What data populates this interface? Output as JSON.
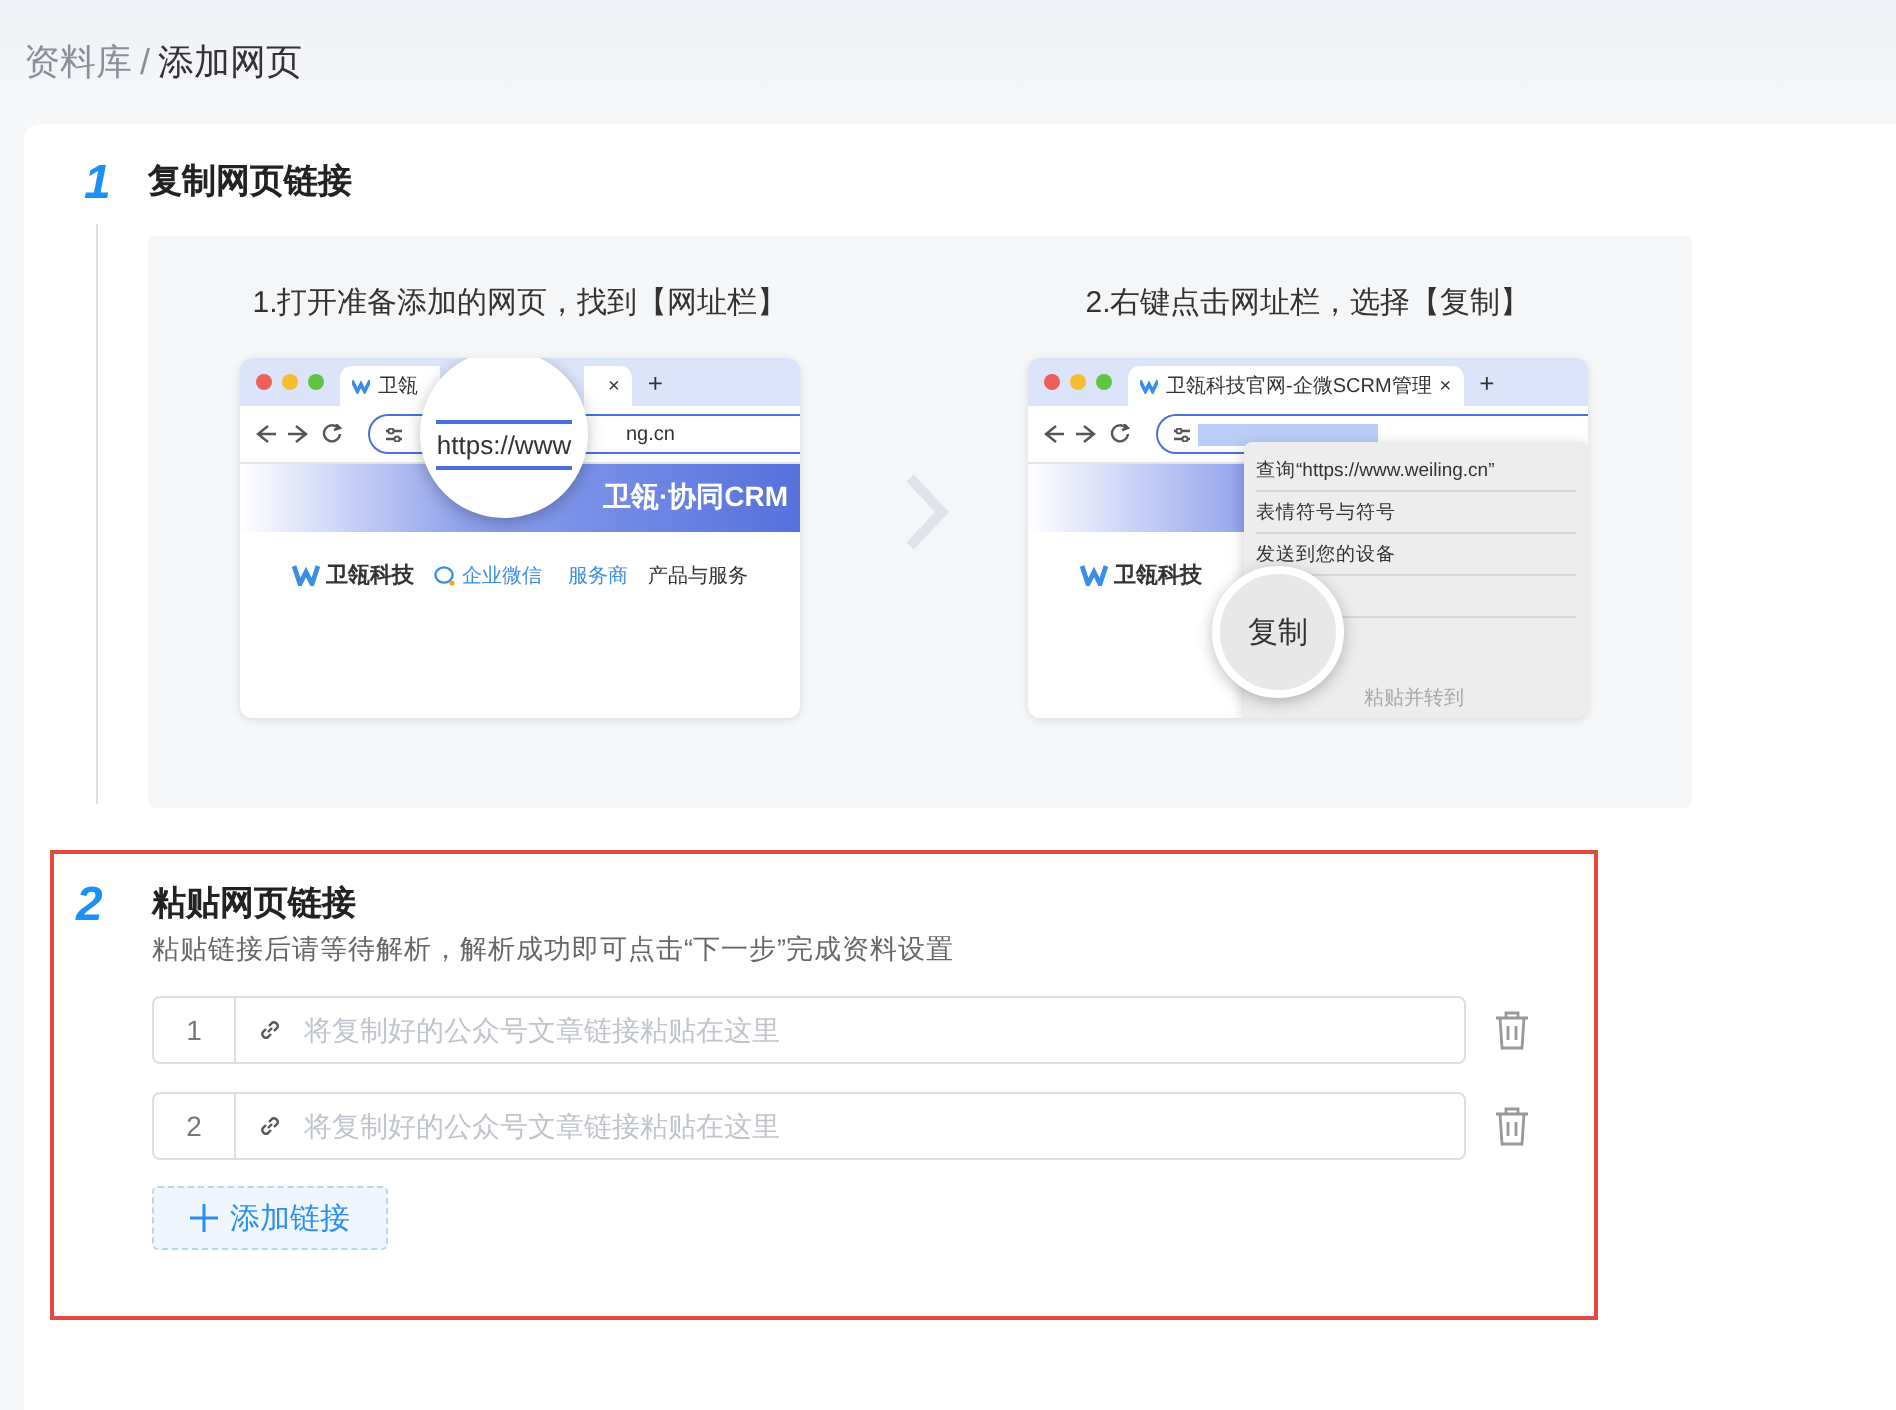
{
  "breadcrumb": {
    "items": [
      {
        "label": "资料库",
        "selected": false
      },
      {
        "label": "添加网页",
        "selected": true
      }
    ],
    "separator": "/"
  },
  "step1": {
    "number": "1",
    "title": "复制网页链接",
    "panels": [
      {
        "kind": "address-bar",
        "caption": "1.打开准备添加的网页，找到【网址栏】",
        "tab_title": "卫瓴",
        "tab_close": "×",
        "new_tab": "+",
        "url_zoomed": "https://www",
        "url_rest": "ng.cn",
        "banner": "卫瓴·协同CRM",
        "logo": "卫瓴科技",
        "nav": [
          "企业微信",
          "服务商",
          "产品与服务"
        ]
      },
      {
        "kind": "context-menu",
        "caption": "2.右键点击网址栏，选择【复制】",
        "tab_title": "卫瓴科技官网-企微SCRM管理",
        "tab_close": "×",
        "new_tab": "+",
        "logo": "卫瓴科技",
        "menu": [
          "查询“https://www.weiling.cn”",
          "表情符号与符号",
          "发送到您的设备"
        ],
        "zoomed": "复制",
        "faded": "粘贴并转到"
      }
    ]
  },
  "step2": {
    "number": "2",
    "title": "粘贴网页链接",
    "highlighted": true,
    "hint": "粘贴链接后请等待解析，解析成功即可点击“下一步”完成资料设置",
    "links": [
      {
        "index": "1",
        "placeholder": "将复制好的公众号文章链接粘贴在这里"
      },
      {
        "index": "2",
        "placeholder": "将复制好的公众号文章链接粘贴在这里"
      }
    ],
    "add_button": "添加链接"
  }
}
